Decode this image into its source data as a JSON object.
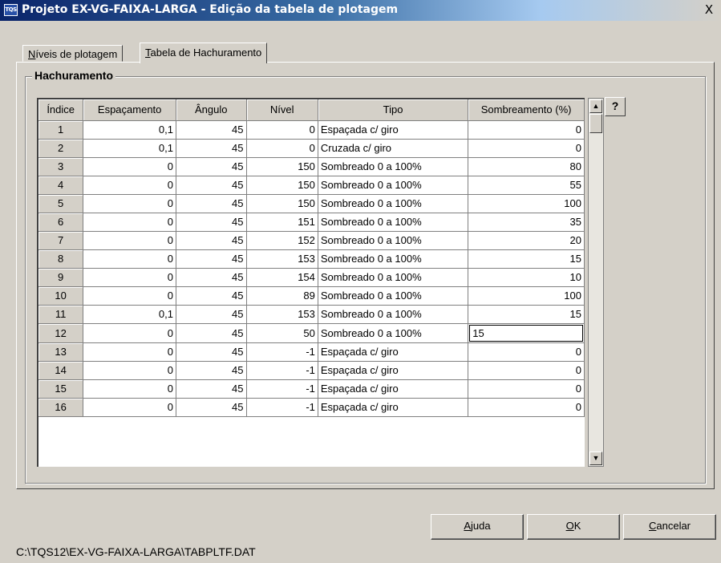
{
  "window": {
    "app_icon_text": "TQS",
    "title": "Projeto EX-VG-FAIXA-LARGA - Edição da tabela de plotagem",
    "close_label": "X"
  },
  "tabs": [
    {
      "underline": "N",
      "rest": "íveis de plotagem",
      "active": false
    },
    {
      "underline": "T",
      "rest": "abela de Hachuramento",
      "active": true
    }
  ],
  "group": {
    "title": "Hachuramento"
  },
  "table": {
    "columns": [
      "Índice",
      "Espaçamento",
      "Ângulo",
      "Nível",
      "Tipo",
      "Sombreamento (%)"
    ],
    "rows": [
      [
        "1",
        "0,1",
        "45",
        "0",
        "Espaçada c/ giro",
        "0"
      ],
      [
        "2",
        "0,1",
        "45",
        "0",
        "Cruzada c/ giro",
        "0"
      ],
      [
        "3",
        "0",
        "45",
        "150",
        "Sombreado 0 a 100%",
        "80"
      ],
      [
        "4",
        "0",
        "45",
        "150",
        "Sombreado 0 a 100%",
        "55"
      ],
      [
        "5",
        "0",
        "45",
        "150",
        "Sombreado 0 a 100%",
        "100"
      ],
      [
        "6",
        "0",
        "45",
        "151",
        "Sombreado 0 a 100%",
        "35"
      ],
      [
        "7",
        "0",
        "45",
        "152",
        "Sombreado 0 a 100%",
        "20"
      ],
      [
        "8",
        "0",
        "45",
        "153",
        "Sombreado 0 a 100%",
        "15"
      ],
      [
        "9",
        "0",
        "45",
        "154",
        "Sombreado 0 a 100%",
        "10"
      ],
      [
        "10",
        "0",
        "45",
        "89",
        "Sombreado 0 a 100%",
        "100"
      ],
      [
        "11",
        "0,1",
        "45",
        "153",
        "Sombreado 0 a 100%",
        "15"
      ],
      [
        "12",
        "0",
        "45",
        "50",
        "Sombreado 0 a 100%",
        "15"
      ],
      [
        "13",
        "0",
        "45",
        "-1",
        "Espaçada c/ giro",
        "0"
      ],
      [
        "14",
        "0",
        "45",
        "-1",
        "Espaçada c/ giro",
        "0"
      ],
      [
        "15",
        "0",
        "45",
        "-1",
        "Espaçada c/ giro",
        "0"
      ],
      [
        "16",
        "0",
        "45",
        "-1",
        "Espaçada c/ giro",
        "0"
      ]
    ],
    "editing_row": 11
  },
  "help_button_label": "?",
  "buttons": [
    {
      "underline": "A",
      "rest": "juda"
    },
    {
      "underline": "O",
      "rest": "K"
    },
    {
      "underline": "C",
      "rest": "ancelar"
    }
  ],
  "status_path": "C:\\TQS12\\EX-VG-FAIXA-LARGA\\TABPLTF.DAT"
}
